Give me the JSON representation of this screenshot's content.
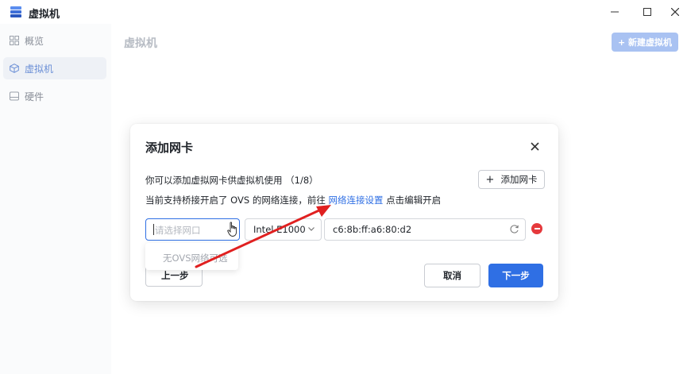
{
  "window": {
    "title": "虚拟机"
  },
  "sidebar": {
    "items": [
      {
        "label": "概览",
        "icon": "grid-icon"
      },
      {
        "label": "虚拟机",
        "icon": "cube-icon",
        "active": true
      },
      {
        "label": "硬件",
        "icon": "hard-drive-icon"
      }
    ]
  },
  "main": {
    "title": "虚拟机",
    "new_vm_label": "+ 新建虚拟机"
  },
  "dialog": {
    "title": "添加网卡",
    "desc_line1": "你可以添加虚拟网卡供虚拟机使用 （1/8）",
    "desc_line2_prefix": "当前支持桥接开启了 OVS 的网络连接，前往 ",
    "desc_line2_link": "网络连接设置",
    "desc_line2_suffix": " 点击编辑开启",
    "add_nic_label": "添加网卡",
    "port_select_placeholder": "请选择网口",
    "port_dropdown_empty": "无OVS网络可选",
    "model_value": "Intel E1000",
    "mac_value": "c6:8b:ff:a6:80:d2",
    "prev_label": "上一步",
    "cancel_label": "取消",
    "next_label": "下一步"
  },
  "colors": {
    "primary": "#2f6fe4",
    "danger": "#e5393c",
    "annotation_arrow": "#e02020"
  }
}
